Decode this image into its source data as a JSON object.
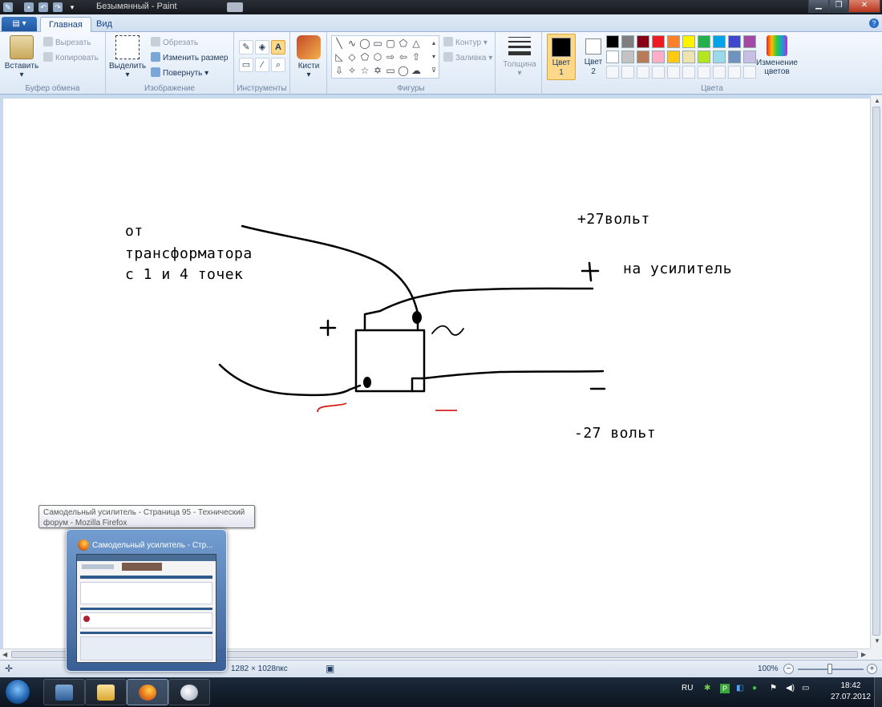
{
  "window": {
    "title": "Безымянный - Paint"
  },
  "tabs": {
    "app_menu": "▤ ▾",
    "home": "Главная",
    "view": "Вид"
  },
  "ribbon": {
    "clipboard": {
      "paste": "Вставить",
      "cut": "Вырезать",
      "copy": "Копировать",
      "label": "Буфер обмена"
    },
    "image": {
      "select": "Выделить",
      "crop": "Обрезать",
      "resize": "Изменить размер",
      "rotate": "Повернуть",
      "label": "Изображение"
    },
    "tools": {
      "label": "Инструменты",
      "text_tool": "A"
    },
    "brushes": {
      "label": "Кисти"
    },
    "shapes": {
      "outline": "Контур",
      "fill": "Заливка",
      "label": "Фигуры"
    },
    "size": {
      "label": "Толщина"
    },
    "colors": {
      "color1": "Цвет 1",
      "color2": "Цвет 2",
      "edit": "Изменение цветов",
      "label": "Цвета",
      "color1_value": "#000000",
      "color2_value": "#ffffff",
      "palette_row1": [
        "#000000",
        "#7f7f7f",
        "#880015",
        "#ed1c24",
        "#ff7f27",
        "#fff200",
        "#22b14c",
        "#00a2e8",
        "#3f48cc",
        "#a349a4"
      ],
      "palette_row2": [
        "#ffffff",
        "#c3c3c3",
        "#b97a57",
        "#ffaec9",
        "#ffc90e",
        "#efe4b0",
        "#b5e61d",
        "#99d9ea",
        "#7092be",
        "#c8bfe7"
      ]
    }
  },
  "drawing": {
    "from_transformer": [
      "от",
      "трансформатора",
      "с 1 и 4 точек"
    ],
    "plus27": "+27вольт",
    "plus_sign": "+",
    "to_amp": "на усилитель",
    "minus_sign": "—",
    "minus27": "-27 вольт",
    "left_plus": "+",
    "tilde": "~"
  },
  "status": {
    "dimensions": "1282 × 1028пкс",
    "zoom": "100%"
  },
  "tooltip": {
    "text": "Самодельный усилитель - Страница 95 - Технический форум - Mozilla Firefox"
  },
  "preview": {
    "title": "Самодельный усилитель - Стр..."
  },
  "taskbar": {
    "lang": "RU",
    "time": "18:42",
    "date": "27.07.2012"
  }
}
